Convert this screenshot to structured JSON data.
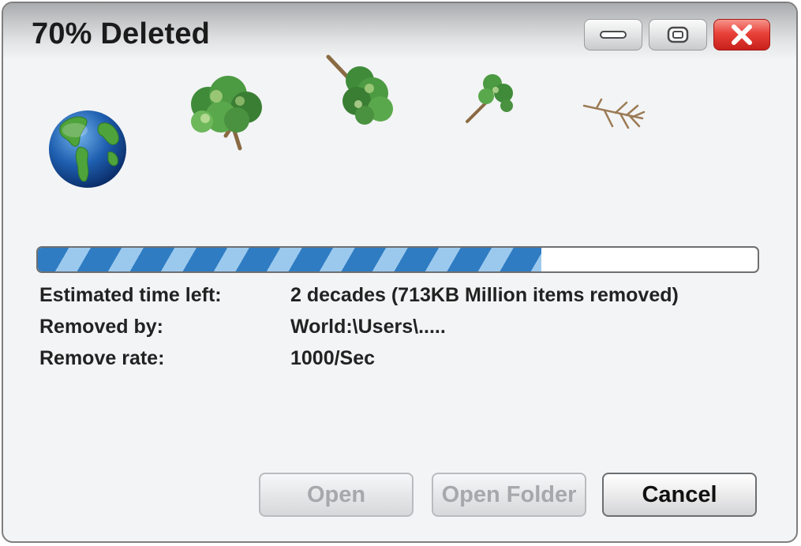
{
  "window": {
    "title": "70% Deleted",
    "controls": {
      "minimize_icon": "minimize-icon",
      "maximize_icon": "restore-icon",
      "close_icon": "close-icon"
    }
  },
  "illustration": {
    "items": [
      "globe-icon",
      "tree-icon",
      "tree-icon",
      "tree-icon",
      "tree-icon"
    ]
  },
  "progress": {
    "fraction": 0.7,
    "fill_color": "#2f7cc2",
    "stripe_color": "#9bc9ee"
  },
  "details": [
    {
      "label": "Estimated time left:",
      "value": "2 decades (713KB Million items removed)"
    },
    {
      "label": "Removed by:",
      "value": "World:\\Users\\....."
    },
    {
      "label": "Remove rate:",
      "value": "1000/Sec"
    }
  ],
  "buttons": {
    "open": "Open",
    "open_folder": "Open Folder",
    "cancel": "Cancel"
  },
  "colors": {
    "close_button": "#e8423a",
    "window_background": "#f3f4f5"
  }
}
